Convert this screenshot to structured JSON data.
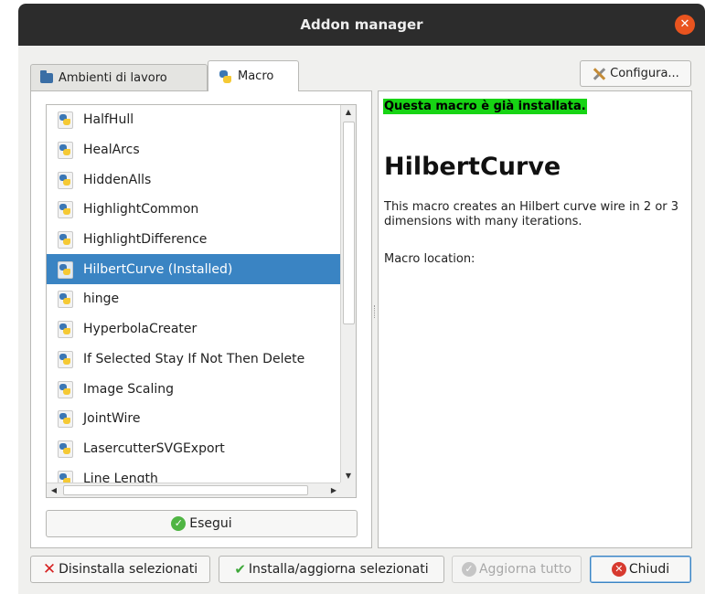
{
  "window": {
    "title": "Addon manager",
    "close_glyph": "✕"
  },
  "tabs": [
    {
      "label": "Ambienti di lavoro",
      "icon": "folder-icon",
      "active": false
    },
    {
      "label": "Macro",
      "icon": "python-icon",
      "active": true
    }
  ],
  "toolbar": {
    "configure_label": "Configura..."
  },
  "macro_list": {
    "items": [
      {
        "label": "HalfHull"
      },
      {
        "label": "HealArcs"
      },
      {
        "label": "HiddenAlls"
      },
      {
        "label": "HighlightCommon"
      },
      {
        "label": "HighlightDifference"
      },
      {
        "label": "HilbertCurve (Installed)",
        "selected": true
      },
      {
        "label": "hinge"
      },
      {
        "label": "HyperbolaCreater"
      },
      {
        "label": "If Selected Stay If Not Then Delete"
      },
      {
        "label": "Image Scaling"
      },
      {
        "label": "JointWire"
      },
      {
        "label": "LasercutterSVGExport"
      },
      {
        "label": "Line Length"
      }
    ],
    "run_label": "Esegui"
  },
  "detail": {
    "status": "Questa macro è già installata.",
    "status_color": "#17d414",
    "title": "HilbertCurve",
    "description": "This macro creates an Hilbert curve wire in 2 or 3 dimensions with many iterations.",
    "location_label": "Macro location:"
  },
  "buttons": {
    "uninstall": "Disinstalla selezionati",
    "install": "Installa/aggiorna selezionati",
    "update_all": "Aggiorna tutto",
    "close": "Chiudi"
  },
  "colors": {
    "selection": "#3a84c3",
    "titlebar": "#2c2c2c",
    "close_button": "#e9541f"
  }
}
